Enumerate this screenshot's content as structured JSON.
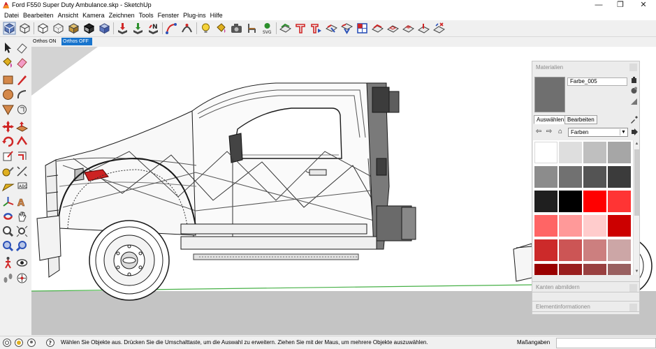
{
  "window": {
    "title": "Ford F550 Super Duty Ambulance.skp - SketchUp",
    "icon": "sketchup-logo-icon",
    "controls": {
      "minimize": "—",
      "restore": "❐",
      "close": "✕"
    }
  },
  "menu": [
    "Datei",
    "Bearbeiten",
    "Ansicht",
    "Kamera",
    "Zeichnen",
    "Tools",
    "Fenster",
    "Plug-ins",
    "Hilfe"
  ],
  "toolbar": {
    "icons": [
      "iso-view-icon",
      "wireframe-icon",
      "hidden-line-icon",
      "xray-icon",
      "shaded-icon",
      "shaded-texture-icon",
      "monochrome-icon",
      "export-icon",
      "import-icon",
      "n-sandbox-icon",
      "curve-icon",
      "arc-icon",
      "bulb-icon",
      "paint-bucket-icon",
      "camera-icon",
      "chair-icon",
      "svg-export-icon",
      "stamp-icon",
      "drape-icon",
      "smoove-icon",
      "flip-icon",
      "add-detail-icon",
      "grid-icon",
      "terrain-icon",
      "contours-icon",
      "from-scratch-icon",
      "fencing-icon",
      "tile-icon"
    ]
  },
  "ortho": {
    "on_label": "Orthos ON",
    "off_label": "Orthos OFF"
  },
  "left_palette_icons": [
    "select-icon",
    "eraser-icon",
    "paint-icon",
    "eraser-pink-icon",
    "rectangle-icon",
    "line-pencil-icon",
    "circle-icon",
    "arc-tool-icon",
    "pushpull-icon",
    "offset-icon",
    "move-icon",
    "pushpull-red-icon",
    "rotate-icon",
    "followme-icon",
    "scale-icon",
    "offset-red-icon",
    "tape-measure-icon",
    "dimension-icon",
    "protractor-icon",
    "text-tool-icon",
    "axes-icon",
    "3d-text-icon",
    "orbit-icon",
    "pan-icon",
    "zoom-icon",
    "zoom-window-icon",
    "zoom-extents-icon",
    "previous-view-icon",
    "walk-icon",
    "look-around-icon",
    "footprint-icon",
    "position-camera-icon"
  ],
  "materials": {
    "title": "Materialien",
    "current_name": "Farbe_005",
    "current_color": "#6f6f6f",
    "tabs": [
      "Auswählen",
      "Bearbeiten"
    ],
    "library": "Farben",
    "swatches": [
      "#ffffff",
      "#dedede",
      "#bfbfbf",
      "#a6a6a6",
      "#8c8c8c",
      "#717171",
      "#545454",
      "#3b3b3b",
      "#1f1f1f",
      "#000000",
      "#ff0000",
      "#ff3434",
      "#ff6565",
      "#ff9999",
      "#ffcccc",
      "#cc0000",
      "#cc2a2a",
      "#cc5555",
      "#cc7f7f",
      "#cca6a6",
      "#990000",
      "#991f1f",
      "#994040",
      "#996060"
    ]
  },
  "panels": [
    {
      "title": "Kanten abmildern"
    },
    {
      "title": "Elementinformationen"
    }
  ],
  "status": {
    "icons": [
      "geo-location-icon",
      "credits-icon",
      "user-icon",
      "help-icon"
    ],
    "text": "Wählen Sie Objekte aus. Drücken Sie die Umschalttaste, um die Auswahl zu erweitern. Ziehen Sie mit der Maus, um mehrere Objekte auszuwählen.",
    "measure_label": "Maßangaben",
    "measure_value": ""
  }
}
